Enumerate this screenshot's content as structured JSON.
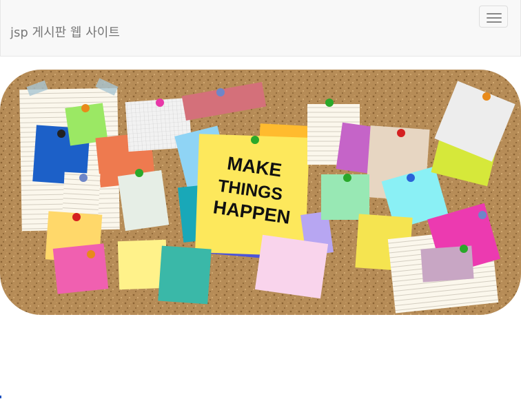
{
  "navbar": {
    "brand": "jsp 게시판 웹 사이트",
    "toggle_icon": "hamburger-menu-icon"
  },
  "hero": {
    "description": "corkboard-with-sticky-notes",
    "note_lines": [
      "MAKE",
      "THINGS",
      "HAPPEN"
    ]
  },
  "colors": {
    "navbar_bg": "#f8f8f8",
    "brand_text": "#777777",
    "cork": "#b48a55"
  }
}
